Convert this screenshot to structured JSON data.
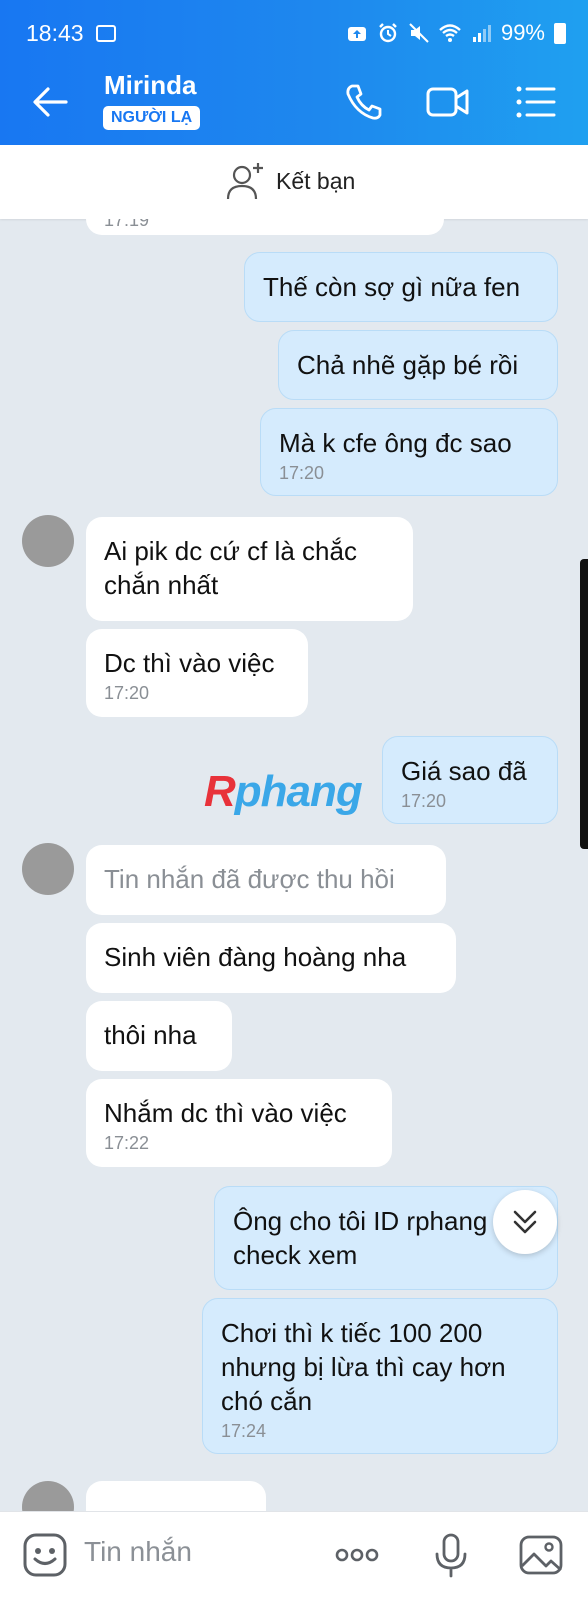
{
  "status_bar": {
    "time": "18:43",
    "battery": "99%"
  },
  "header": {
    "contact_name": "Mirinda",
    "badge": "NGƯỜI LẠ"
  },
  "add_friend": {
    "label": "Kết bạn"
  },
  "messages": [
    {
      "text": "17:19"
    },
    {
      "text": "Thế còn sợ gì nữa fen"
    },
    {
      "text": "Chả nhẽ gặp bé rồi"
    },
    {
      "text": "Mà k cfe ông đc sao",
      "time": "17:20"
    },
    {
      "text": "Ai pik dc cứ cf là chắc chắn nhất"
    },
    {
      "text": "Dc thì vào việc",
      "time": "17:20"
    },
    {
      "text": "Giá sao đã",
      "time": "17:20"
    },
    {
      "text": "Tin nhắn đã được thu hồi"
    },
    {
      "text": "Sinh viên đàng hoàng nha"
    },
    {
      "text": "thôi nha"
    },
    {
      "text": "Nhắm dc thì vào việc",
      "time": "17:22"
    },
    {
      "text": "Ông cho tôi ID rphang t check xem"
    },
    {
      "text": "Chơi thì k tiếc 100 200 nhưng bị lừa thì cay hơn chó cắn",
      "time": "17:24"
    }
  ],
  "watermark": {
    "part1": "R",
    "part2": "phang"
  },
  "composer": {
    "placeholder": "Tin nhắn"
  },
  "colors": {
    "header": "#1877f2",
    "outgoing_bubble": "#d5ebfd",
    "incoming_bubble": "#ffffff",
    "background": "#e3e9ef"
  }
}
